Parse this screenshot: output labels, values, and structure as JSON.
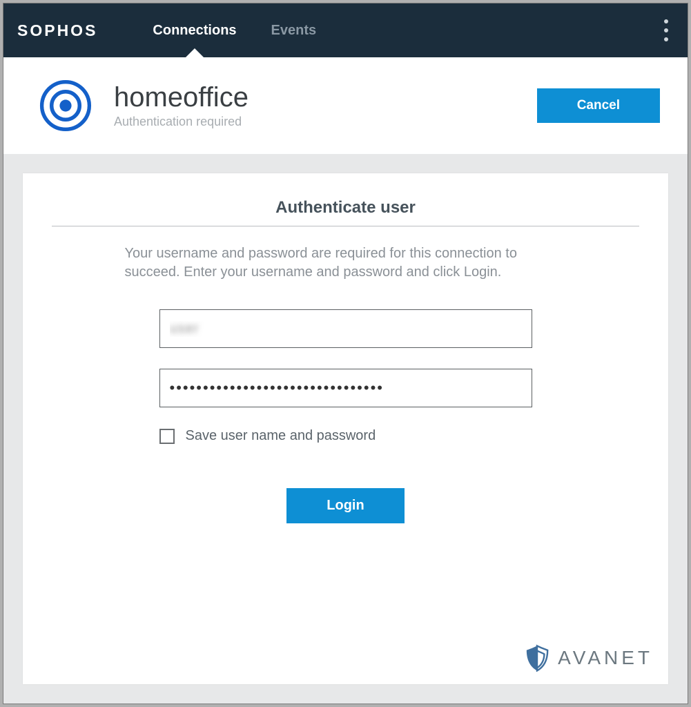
{
  "brand": "SOPHOS",
  "nav": {
    "tabs": [
      {
        "label": "Connections",
        "active": true
      },
      {
        "label": "Events",
        "active": false
      }
    ]
  },
  "connection": {
    "title": "homeoffice",
    "subtitle": "Authentication required",
    "cancel_label": "Cancel"
  },
  "auth": {
    "heading": "Authenticate user",
    "description": "Your username and password are required for this connection to succeed. Enter your username and password and click Login.",
    "username_value": "user",
    "password_value": "••••••••••••••••••••••••••••••••",
    "save_label": "Save user name and password",
    "login_label": "Login"
  },
  "watermark": {
    "label": "AVANET"
  },
  "colors": {
    "accent": "#0e8fd4",
    "navbar": "#1b2d3c"
  }
}
